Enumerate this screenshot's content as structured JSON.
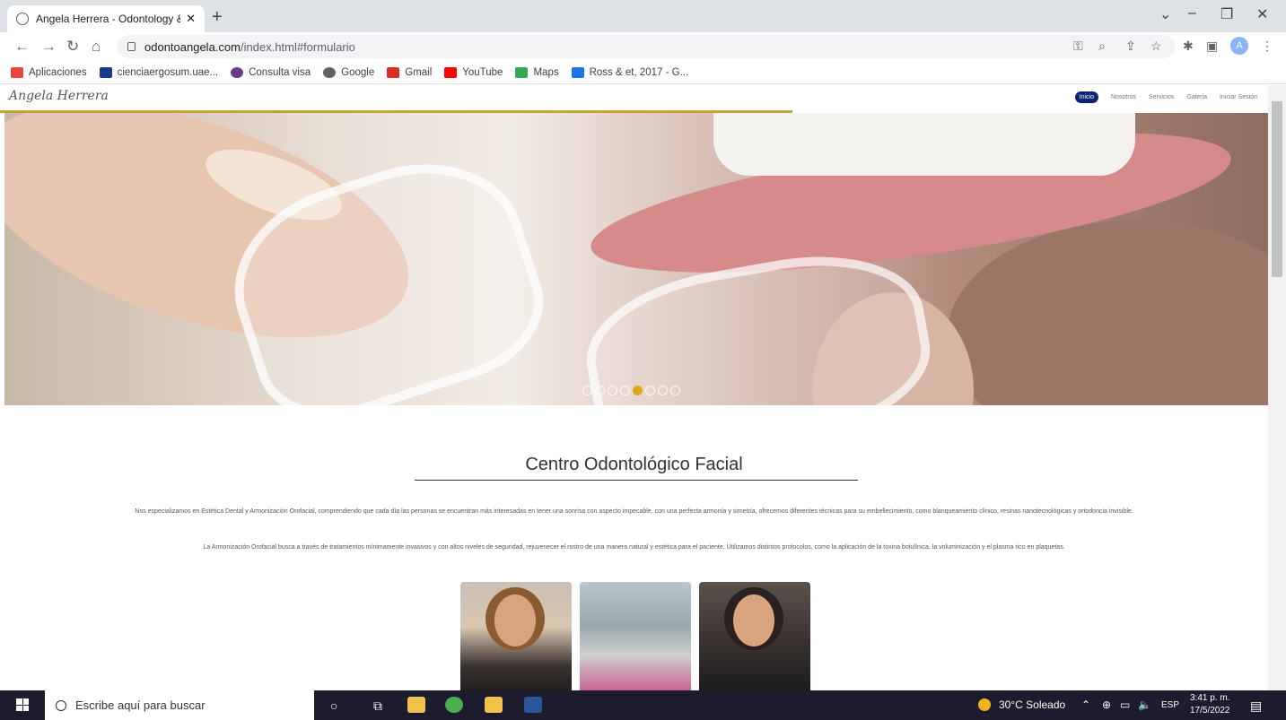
{
  "browser": {
    "tab_title": "Angela Herrera - Odontology & ",
    "url_host": "odontoangela.com",
    "url_path": "/index.html#formulario",
    "profile_initial": "A",
    "bookmarks": [
      {
        "label": "Aplicaciones",
        "color": "#e8453c"
      },
      {
        "label": "cienciaergosum.uae...",
        "color": "#1a3a8a"
      },
      {
        "label": "Consulta visa",
        "color": "#6b3a8a"
      },
      {
        "label": "Google",
        "color": "#5f6368"
      },
      {
        "label": "Gmail",
        "color": "#d93025"
      },
      {
        "label": "YouTube",
        "color": "#ff0000"
      },
      {
        "label": "Maps",
        "color": "#34a853"
      },
      {
        "label": "Ross & et, 2017 - G...",
        "color": "#1a73e8"
      }
    ]
  },
  "site": {
    "logo_text": "Angela Herrera",
    "nav": [
      {
        "label": "Inicio",
        "active": true
      },
      {
        "label": "Nosotros"
      },
      {
        "label": "Servicios"
      },
      {
        "label": "Galeria"
      },
      {
        "label": "Iniciar Sesión"
      }
    ],
    "carousel": {
      "count": 8,
      "active_index": 4
    },
    "heading": "Centro Odontológico Facial",
    "paragraph1": "Nos especializamos en Estética Dental y Armonización Orofacial, comprendiendo que cada día las personas se encuentran más interesadas en tener una sonrisa con aspecto impecable, con una perfecta armonía y simetría, ofrecemos diferentes técnicas para su embellecimiento, como blanqueamiento clínico, resinas nanotecnológicas y ortodoncia invisible.",
    "paragraph2": "La Armonización Orofacial busca a través de tratamientos mínimamente invasivos y con altos niveles de seguridad, rejuvenecer el rostro de una manera natural y estética para el paciente. Utilizamos distintos protocolos, como la aplicación de la toxina botulínica, la voluminización y el plasma rico en plaquetas."
  },
  "taskbar": {
    "search_placeholder": "Escribe aquí para buscar",
    "weather": "30°C Soleado",
    "lang": "ESP",
    "time": "3:41 p. m.",
    "date": "17/5/2022"
  }
}
